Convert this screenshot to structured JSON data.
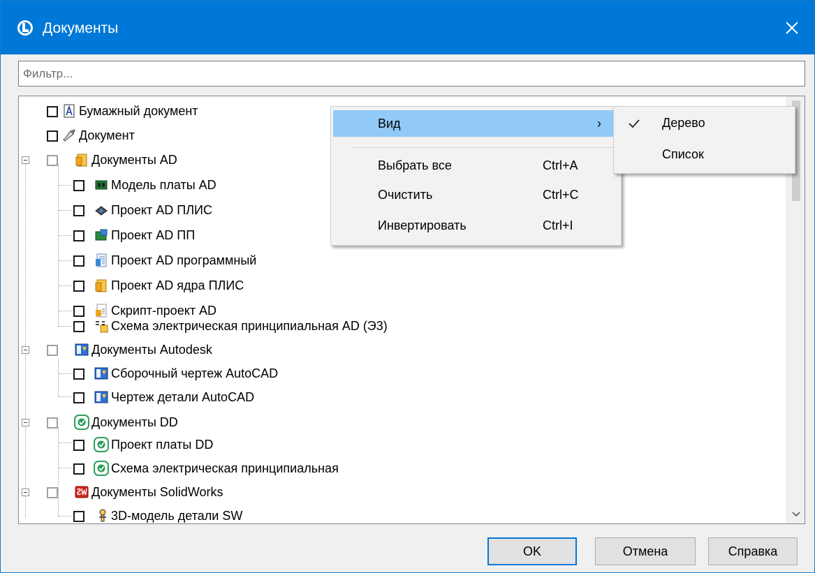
{
  "window": {
    "title": "Документы",
    "close_symbol": "✕",
    "accent_color": "#0078d7"
  },
  "filter": {
    "placeholder": "Фильтр...",
    "value": ""
  },
  "tree": {
    "items": [
      {
        "label": "Бумажный документ",
        "icon": "paper-document-icon"
      },
      {
        "label": "Документ",
        "icon": "document-icon"
      },
      {
        "label": "Документы AD",
        "icon": "ad-documents-icon"
      },
      {
        "label": "Модель платы AD",
        "icon": "board-model-icon"
      },
      {
        "label": "Проект AD ПЛИС",
        "icon": "fpga-project-icon"
      },
      {
        "label": "Проект AD ПП",
        "icon": "pcb-project-icon"
      },
      {
        "label": "Проект AD программный",
        "icon": "software-project-icon"
      },
      {
        "label": "Проект AD ядра ПЛИС",
        "icon": "fpga-core-project-icon"
      },
      {
        "label": "Скрипт-проект AD",
        "icon": "script-project-icon"
      },
      {
        "label": "Схема электрическая принципиальная AD (Э3)",
        "icon": "schematic-e3-icon"
      },
      {
        "label": "Документы Autodesk",
        "icon": "autodesk-icon"
      },
      {
        "label": "Сборочный чертеж AutoCAD",
        "icon": "autocad-assembly-icon"
      },
      {
        "label": "Чертеж детали AutoCAD",
        "icon": "autocad-part-icon"
      },
      {
        "label": "Документы DD",
        "icon": "dd-icon"
      },
      {
        "label": "Проект платы DD",
        "icon": "dd-board-icon"
      },
      {
        "label": "Схема электрическая принципиальная",
        "icon": "dd-schematic-icon"
      },
      {
        "label": "Документы SolidWorks",
        "icon": "solidworks-icon"
      },
      {
        "label": "3D-модель детали SW",
        "icon": "sw-part-icon"
      }
    ]
  },
  "context_menu": {
    "items": [
      {
        "label": "Вид",
        "shortcut": "",
        "arrow": "›"
      },
      {
        "label": "Выбрать все",
        "shortcut": "Ctrl+A"
      },
      {
        "label": "Очистить",
        "shortcut": "Ctrl+C"
      },
      {
        "label": "Инвертировать",
        "shortcut": "Ctrl+I"
      }
    ]
  },
  "submenu": {
    "items": [
      {
        "label": "Дерево",
        "checked": true
      },
      {
        "label": "Список",
        "checked": false
      }
    ]
  },
  "buttons": {
    "ok": "OK",
    "cancel": "Отмена",
    "help": "Справка"
  }
}
